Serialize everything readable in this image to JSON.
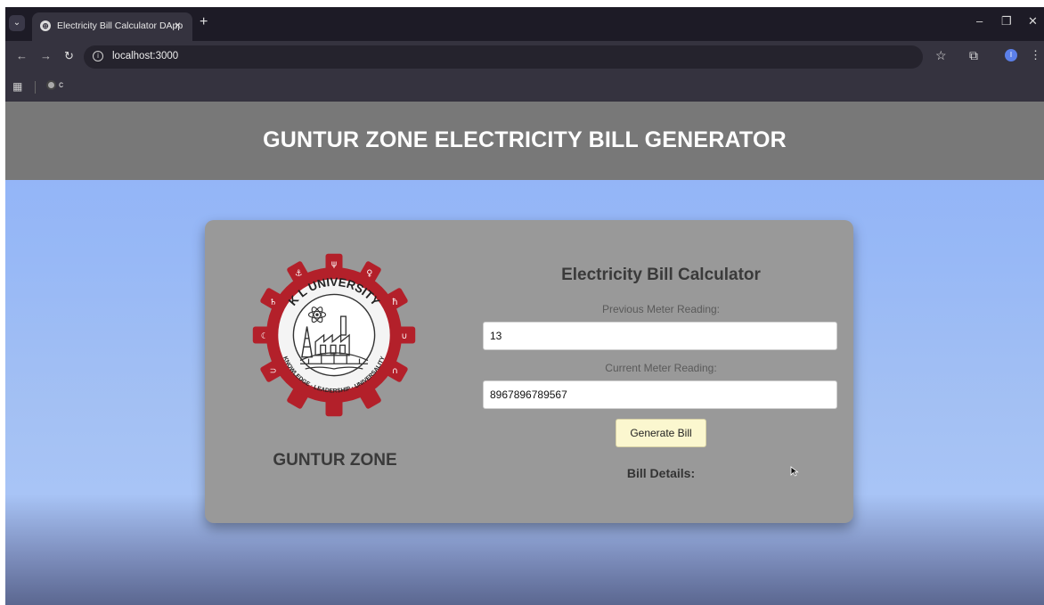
{
  "browser": {
    "tab_title": "Electricity Bill Calculator DApp",
    "tab_close": "×",
    "new_tab": "+",
    "url": "localhost:3000",
    "bookmark_label": "c",
    "profile_initial": "I",
    "icons": [
      "tab-search-icon",
      "globe-icon",
      "back-icon",
      "forward-icon",
      "reload-icon",
      "info-icon",
      "star-icon",
      "extensions-icon",
      "profile-icon",
      "menu-icon",
      "apps-icon",
      "minimize-icon",
      "restore-icon",
      "close-icon"
    ]
  },
  "header": {
    "title": "GUNTUR ZONE ELECTRICITY BILL GENERATOR"
  },
  "card": {
    "logo": {
      "top_text": "K L UNIVERSITY",
      "bottom_text": "KNOWLEDGE · LEADERSHIP · UNIVERSALITY"
    },
    "zone_label": "GUNTUR ZONE",
    "calc_title": "Electricity Bill Calculator",
    "previous_label": "Previous Meter Reading:",
    "previous_value": "13",
    "current_label": "Current Meter Reading:",
    "current_value": "8967896789567",
    "button_label": "Generate Bill",
    "bill_details_label": "Bill Details:"
  },
  "colors": {
    "header_bg": "#787878",
    "card_bg": "#999999",
    "page_bg": "#97b8f6",
    "button_bg": "#fbf7cf",
    "logo_red": "#b3202a"
  }
}
